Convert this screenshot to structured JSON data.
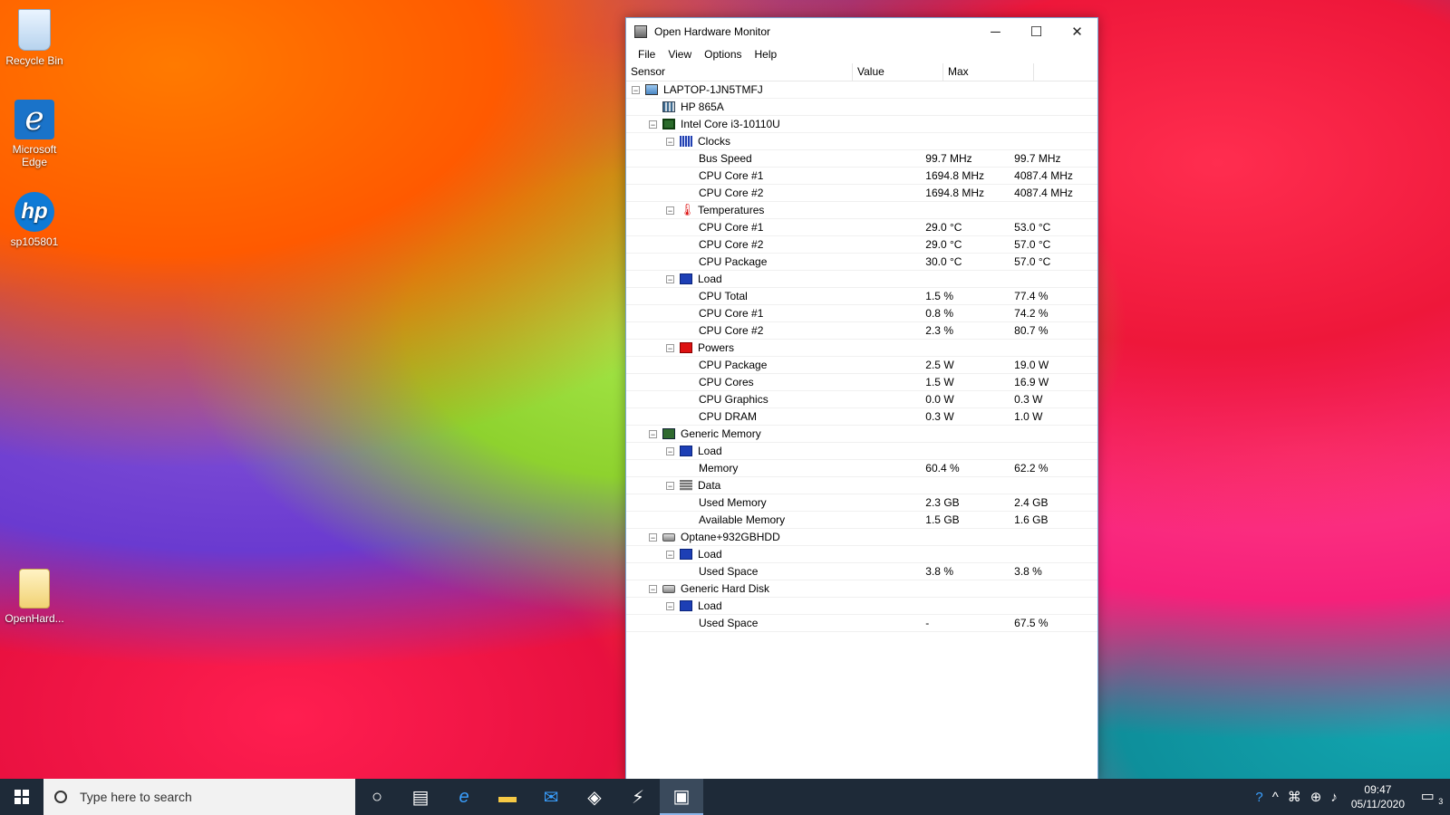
{
  "desktop": {
    "icons": [
      {
        "label": "Recycle Bin"
      },
      {
        "label": "Microsoft Edge"
      },
      {
        "label": "sp105801"
      },
      {
        "label": "OpenHard..."
      }
    ]
  },
  "window": {
    "title": "Open Hardware Monitor",
    "menu": [
      "File",
      "View",
      "Options",
      "Help"
    ],
    "columns": {
      "sensor": "Sensor",
      "value": "Value",
      "max": "Max"
    },
    "rows": [
      {
        "level": 0,
        "toggle": "−",
        "icon": "computer",
        "name": "LAPTOP-1JN5TMFJ",
        "value": "",
        "max": ""
      },
      {
        "level": 1,
        "toggle": "",
        "icon": "board",
        "name": "HP 865A",
        "value": "",
        "max": ""
      },
      {
        "level": 1,
        "toggle": "−",
        "icon": "cpu",
        "name": "Intel Core i3-10110U",
        "value": "",
        "max": ""
      },
      {
        "level": 2,
        "toggle": "−",
        "icon": "clock",
        "name": "Clocks",
        "value": "",
        "max": ""
      },
      {
        "level": 3,
        "toggle": "",
        "icon": "",
        "name": "Bus Speed",
        "value": "99.7 MHz",
        "max": "99.7 MHz"
      },
      {
        "level": 3,
        "toggle": "",
        "icon": "",
        "name": "CPU Core #1",
        "value": "1694.8 MHz",
        "max": "4087.4 MHz"
      },
      {
        "level": 3,
        "toggle": "",
        "icon": "",
        "name": "CPU Core #2",
        "value": "1694.8 MHz",
        "max": "4087.4 MHz"
      },
      {
        "level": 2,
        "toggle": "−",
        "icon": "temp",
        "name": "Temperatures",
        "value": "",
        "max": ""
      },
      {
        "level": 3,
        "toggle": "",
        "icon": "",
        "name": "CPU Core #1",
        "value": "29.0 °C",
        "max": "53.0 °C"
      },
      {
        "level": 3,
        "toggle": "",
        "icon": "",
        "name": "CPU Core #2",
        "value": "29.0 °C",
        "max": "57.0 °C"
      },
      {
        "level": 3,
        "toggle": "",
        "icon": "",
        "name": "CPU Package",
        "value": "30.0 °C",
        "max": "57.0 °C"
      },
      {
        "level": 2,
        "toggle": "−",
        "icon": "load",
        "name": "Load",
        "value": "",
        "max": ""
      },
      {
        "level": 3,
        "toggle": "",
        "icon": "",
        "name": "CPU Total",
        "value": "1.5 %",
        "max": "77.4 %"
      },
      {
        "level": 3,
        "toggle": "",
        "icon": "",
        "name": "CPU Core #1",
        "value": "0.8 %",
        "max": "74.2 %"
      },
      {
        "level": 3,
        "toggle": "",
        "icon": "",
        "name": "CPU Core #2",
        "value": "2.3 %",
        "max": "80.7 %"
      },
      {
        "level": 2,
        "toggle": "−",
        "icon": "power",
        "name": "Powers",
        "value": "",
        "max": ""
      },
      {
        "level": 3,
        "toggle": "",
        "icon": "",
        "name": "CPU Package",
        "value": "2.5 W",
        "max": "19.0 W"
      },
      {
        "level": 3,
        "toggle": "",
        "icon": "",
        "name": "CPU Cores",
        "value": "1.5 W",
        "max": "16.9 W"
      },
      {
        "level": 3,
        "toggle": "",
        "icon": "",
        "name": "CPU Graphics",
        "value": "0.0 W",
        "max": "0.3 W"
      },
      {
        "level": 3,
        "toggle": "",
        "icon": "",
        "name": "CPU DRAM",
        "value": "0.3 W",
        "max": "1.0 W"
      },
      {
        "level": 1,
        "toggle": "−",
        "icon": "mem",
        "name": "Generic Memory",
        "value": "",
        "max": ""
      },
      {
        "level": 2,
        "toggle": "−",
        "icon": "load",
        "name": "Load",
        "value": "",
        "max": ""
      },
      {
        "level": 3,
        "toggle": "",
        "icon": "",
        "name": "Memory",
        "value": "60.4 %",
        "max": "62.2 %"
      },
      {
        "level": 2,
        "toggle": "−",
        "icon": "data",
        "name": "Data",
        "value": "",
        "max": ""
      },
      {
        "level": 3,
        "toggle": "",
        "icon": "",
        "name": "Used Memory",
        "value": "2.3 GB",
        "max": "2.4 GB"
      },
      {
        "level": 3,
        "toggle": "",
        "icon": "",
        "name": "Available Memory",
        "value": "1.5 GB",
        "max": "1.6 GB"
      },
      {
        "level": 1,
        "toggle": "−",
        "icon": "disk",
        "name": "Optane+932GBHDD",
        "value": "",
        "max": ""
      },
      {
        "level": 2,
        "toggle": "−",
        "icon": "load",
        "name": "Load",
        "value": "",
        "max": ""
      },
      {
        "level": 3,
        "toggle": "",
        "icon": "",
        "name": "Used Space",
        "value": "3.8 %",
        "max": "3.8 %"
      },
      {
        "level": 1,
        "toggle": "−",
        "icon": "disk",
        "name": "Generic Hard Disk",
        "value": "",
        "max": ""
      },
      {
        "level": 2,
        "toggle": "−",
        "icon": "load",
        "name": "Load",
        "value": "",
        "max": ""
      },
      {
        "level": 3,
        "toggle": "",
        "icon": "",
        "name": "Used Space",
        "value": "-",
        "max": "67.5 %"
      }
    ]
  },
  "taskbar": {
    "search_placeholder": "Type here to search",
    "time": "09:47",
    "date": "05/11/2020",
    "notification_count": "3"
  },
  "colors": {
    "taskbar": "#1e2a38",
    "window_border": "#7aa7d6"
  }
}
